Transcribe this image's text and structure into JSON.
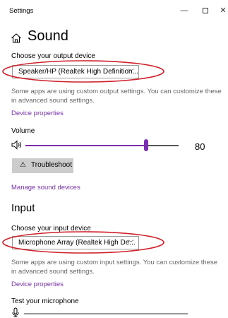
{
  "window": {
    "title": "Settings",
    "minimize": "—",
    "close": "✕"
  },
  "page": {
    "title": "Sound"
  },
  "output": {
    "choose_label": "Choose your output device",
    "device": "Speaker/HP (Realtek High Definition...",
    "description": "Some apps are using custom output settings. You can customize these in advanced sound settings.",
    "device_properties": "Device properties",
    "volume_label": "Volume",
    "volume_value": "80",
    "volume_level_percent": 80,
    "troubleshoot": "Troubleshoot",
    "manage_devices": "Manage sound devices"
  },
  "input": {
    "section_title": "Input",
    "choose_label": "Choose your input device",
    "device": "Microphone Array (Realtek High De...",
    "description": "Some apps are using custom input settings. You can customize these in advanced sound settings.",
    "device_properties": "Device properties",
    "test_label": "Test your microphone"
  },
  "colors": {
    "accent": "#7a2fb0",
    "annotation_red": "#d0202a"
  }
}
